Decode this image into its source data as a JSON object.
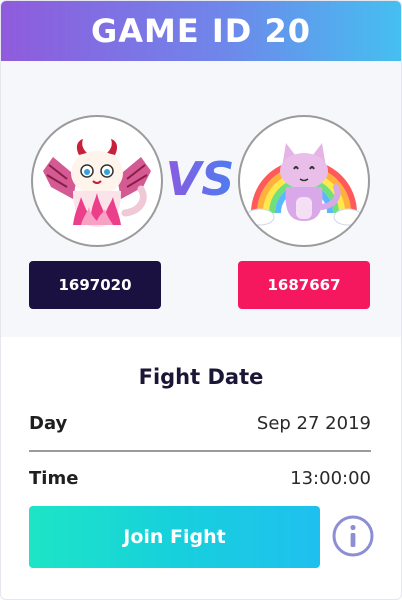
{
  "header": {
    "title": "GAME ID 20",
    "gradient": [
      "#8f5bdc",
      "#45bff0"
    ]
  },
  "matchup": {
    "left_kitty": {
      "icon": "pink-dragon-kitty-icon",
      "id_label": "1697020",
      "badge_color": "#1a1140"
    },
    "vs_label": "VS",
    "right_kitty": {
      "icon": "rainbow-kitty-icon",
      "id_label": "1687667",
      "badge_color": "#f5185e"
    }
  },
  "fight_date": {
    "title": "Fight Date",
    "day_label": "Day",
    "day_value": "Sep 27 2019",
    "time_label": "Time",
    "time_value": "13:00:00"
  },
  "actions": {
    "join_label": "Join Fight",
    "info_icon": "info-icon"
  }
}
